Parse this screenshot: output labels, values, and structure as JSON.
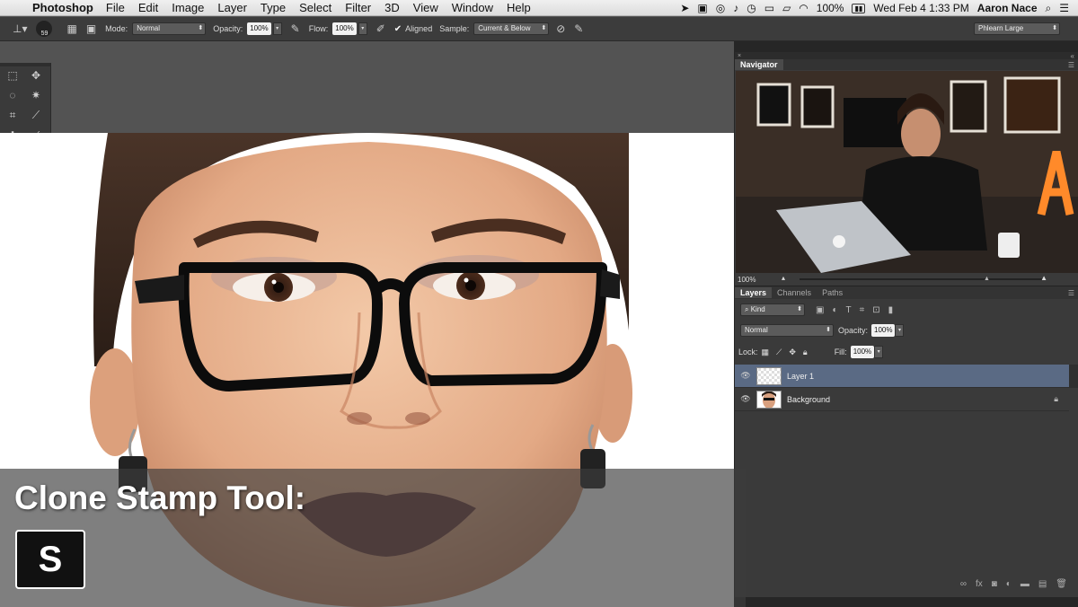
{
  "menubar": {
    "app_name": "Photoshop",
    "menus": [
      "File",
      "Edit",
      "Image",
      "Layer",
      "Type",
      "Select",
      "Filter",
      "3D",
      "View",
      "Window",
      "Help"
    ],
    "battery": "100%",
    "datetime": "Wed Feb 4  1:33 PM",
    "user": "Aaron Nace"
  },
  "options": {
    "brush_size": "59",
    "mode_label": "Mode:",
    "mode_value": "Normal",
    "opacity_label": "Opacity:",
    "opacity_value": "100%",
    "flow_label": "Flow:",
    "flow_value": "100%",
    "aligned_label": "Aligned",
    "sample_label": "Sample:",
    "sample_value": "Current & Below",
    "preset_value": "Phlearn Large"
  },
  "navigator": {
    "tab_label": "Navigator",
    "zoom": "100%"
  },
  "layers": {
    "tabs": [
      "Layers",
      "Channels",
      "Paths"
    ],
    "kind_label": "Kind",
    "blend_mode": "Normal",
    "opacity_label": "Opacity:",
    "opacity_value": "100%",
    "lock_label": "Lock:",
    "fill_label": "Fill:",
    "fill_value": "100%",
    "items": [
      {
        "name": "Layer 1",
        "selected": true
      },
      {
        "name": "Background",
        "selected": false
      }
    ]
  },
  "overlay": {
    "title": "Clone Stamp Tool:",
    "shortcut_key": "S"
  },
  "colors": {
    "selected_layer": "#5a6a84",
    "panel_bg": "#3a3a3a",
    "foreground_swatch": "#555a6e"
  }
}
